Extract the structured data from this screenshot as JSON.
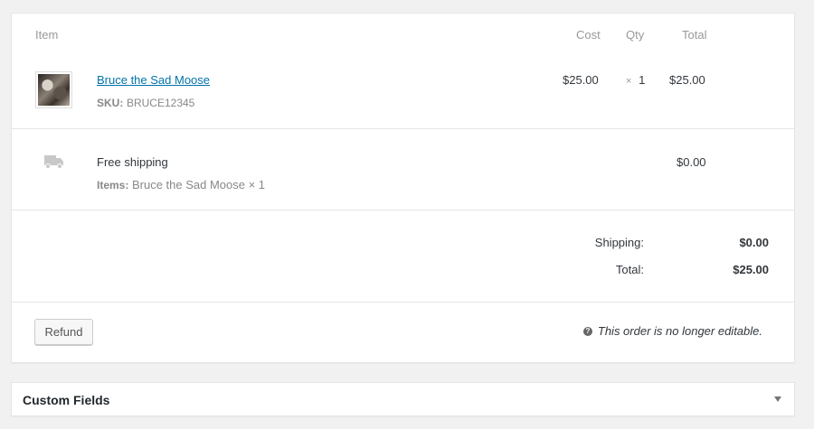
{
  "items_table": {
    "headers": {
      "item": "Item",
      "cost": "Cost",
      "qty": "Qty",
      "total": "Total"
    },
    "line_item": {
      "name": "Bruce the Sad Moose",
      "sku_label": "SKU:",
      "sku_value": "BRUCE12345",
      "cost": "$25.00",
      "qty_prefix": "×",
      "qty": "1",
      "total": "$25.00"
    },
    "shipping_line": {
      "icon": "truck-icon",
      "name": "Free shipping",
      "items_label": "Items:",
      "items_value": "Bruce the Sad Moose × 1",
      "total": "$0.00"
    }
  },
  "totals": {
    "shipping_label": "Shipping:",
    "shipping_value": "$0.00",
    "total_label": "Total:",
    "total_value": "$25.00"
  },
  "actions": {
    "refund_label": "Refund",
    "notice": "This order is no longer editable.",
    "notice_icon": "help-icon"
  },
  "custom_fields": {
    "title": "Custom Fields",
    "toggle_icon": "triangle-down-icon"
  },
  "colors": {
    "link": "#0073aa",
    "background": "#f1f1f1",
    "panel": "#ffffff"
  }
}
